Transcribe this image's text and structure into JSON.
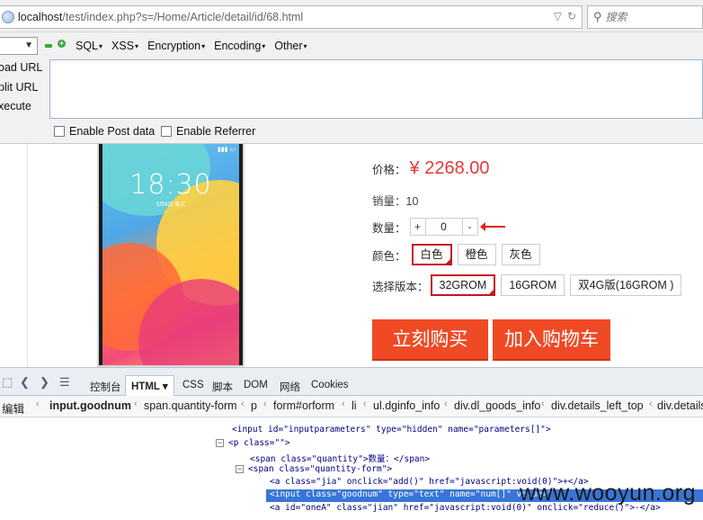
{
  "browser": {
    "url_host": "localhost",
    "url_path": "/test/index.php?s=/Home/Article/detail/id/68.html",
    "search_placeholder": "搜索"
  },
  "hackbar": {
    "menu": [
      "SQL",
      "XSS",
      "Encryption",
      "Encoding",
      "Other"
    ],
    "side_actions": [
      "oad URL",
      "plit URL",
      "xecute"
    ],
    "enable_post": "Enable Post data",
    "enable_referrer": "Enable Referrer"
  },
  "product": {
    "price_label": "价格：",
    "price": "¥ 2268.00",
    "sales": "销量：10",
    "qty_label": "数量：",
    "qty_minus": "+",
    "qty_value": "0",
    "qty_plus": "-",
    "color_label": "颜色：",
    "colors": [
      "白色",
      "橙色",
      "灰色"
    ],
    "version_label": "选择版本：",
    "versions": [
      "32GROM",
      "16GROM",
      "双4G版(16GROM )"
    ],
    "buy_now": "立刻购买",
    "add_to_cart": "加入购物车",
    "phone_time": "18:30",
    "phone_date": "5月8日 周三"
  },
  "firebug": {
    "tabs": [
      "控制台",
      "HTML",
      "CSS",
      "脚本",
      "DOM",
      "网络",
      "Cookies"
    ],
    "active_tab": "HTML",
    "edit": "编辑",
    "breadcrumb": [
      "input.goodnum",
      "span.quantity-form",
      "p",
      "form#orform",
      "li",
      "ul.dginfo_info",
      "div.dl_goods_info",
      "div.details_left_top",
      "div.details"
    ],
    "code_lines": [
      "<input id=\"inputparameters\" type=\"hidden\" name=\"parameters[]\">",
      "<p class=\"\">",
      "<span class=\"quantity\">数量：</span>",
      "<span class=\"quantity-form\">",
      "<a class=\"jia\" onclick=\"add()\" href=\"javascript:void(0)\">+</a>",
      "<input class=\"goodnum\" type=\"text\" name=\"num[]\" value=\"",
      "<a id=\"oneA\" class=\"jian\" href=\"javascript:void(0)\" onclick=\"reduce()\">-</a>"
    ],
    "watermark": "www.wooyun.org"
  },
  "colors": {
    "accent_red": "#e4393c",
    "buy_button": "#f04a25",
    "selection_blue": "#3875d7"
  }
}
